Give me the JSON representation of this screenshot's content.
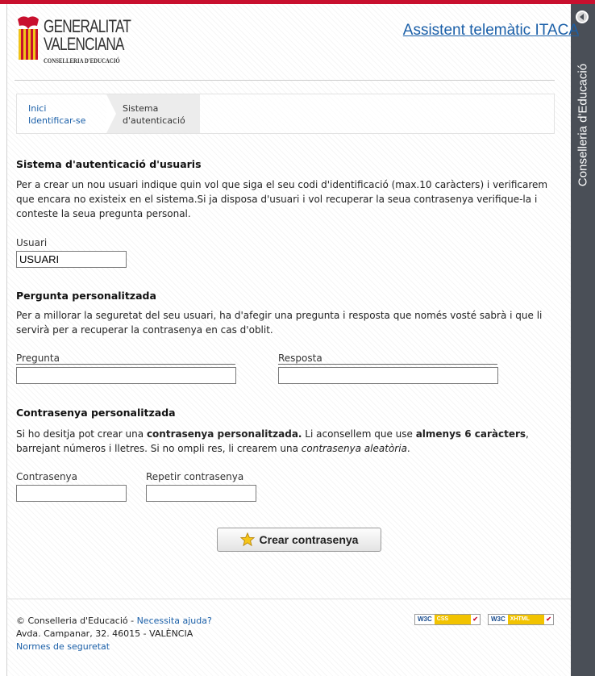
{
  "header": {
    "logo_line1": "GENERALITAT",
    "logo_line2": "VALENCIANA",
    "logo_line3": "CONSELLERIA D'EDUCACIÓ",
    "app_title": "Assistent telemàtic ITACA"
  },
  "sidebar": {
    "vertical_label": "Conselleria d'Educació"
  },
  "breadcrumb": {
    "items": [
      "Inici",
      "Identificar-se"
    ],
    "current": "Sistema d'autenticació"
  },
  "section_user": {
    "title": "Sistema d'autenticació d'usuaris",
    "text": "Per a crear un nou usuari indique quin vol que siga el seu codi d'identificació (max.10 caràcters) i verificarem que encara no existeix en el sistema.Si ja disposa d'usuari i vol recuperar la seua contrasenya verifique-la i conteste la seua pregunta personal.",
    "user_label": "Usuari",
    "user_value": "USUARI"
  },
  "section_question": {
    "title": "Pergunta personalitzada",
    "text": "Per a millorar la seguretat del seu usuari, ha d'afegir una pregunta i resposta que només vosté sabrà i que li servirà per a recuperar la contrasenya en cas d'oblit.",
    "question_label": "Pregunta",
    "answer_label": "Resposta"
  },
  "section_password": {
    "title": "Contrasenya personalitzada",
    "text_part1": "Si ho desitja pot crear una ",
    "text_bold1": "contrasenya personalitzada.",
    "text_part2": " Li aconsellem que use ",
    "text_bold2": "almenys 6 caràcters",
    "text_part3": ", barrejant números i lletres. Si no ompli res, li crearem una ",
    "text_italic": "contrasenya aleatòria",
    "text_part4": ".",
    "password_label": "Contrasenya",
    "repeat_label": "Repetir contrasenya",
    "submit_label": "Crear contrasenya"
  },
  "footer": {
    "copyright": "© Conselleria d'Educació - ",
    "help_link": "Necessita ajuda?",
    "address": "Avda. Campanar, 32. 46015 - VALÈNCIA",
    "security_link": "Normes de seguretat",
    "badge_w3c": "W3C",
    "badge_css": "CSS",
    "badge_xhtml": "XHTML",
    "check": "✔"
  },
  "colors": {
    "brand_red": "#c8102e",
    "link_blue": "#1a5fa8",
    "sidebar_bg": "#4a4f57"
  }
}
